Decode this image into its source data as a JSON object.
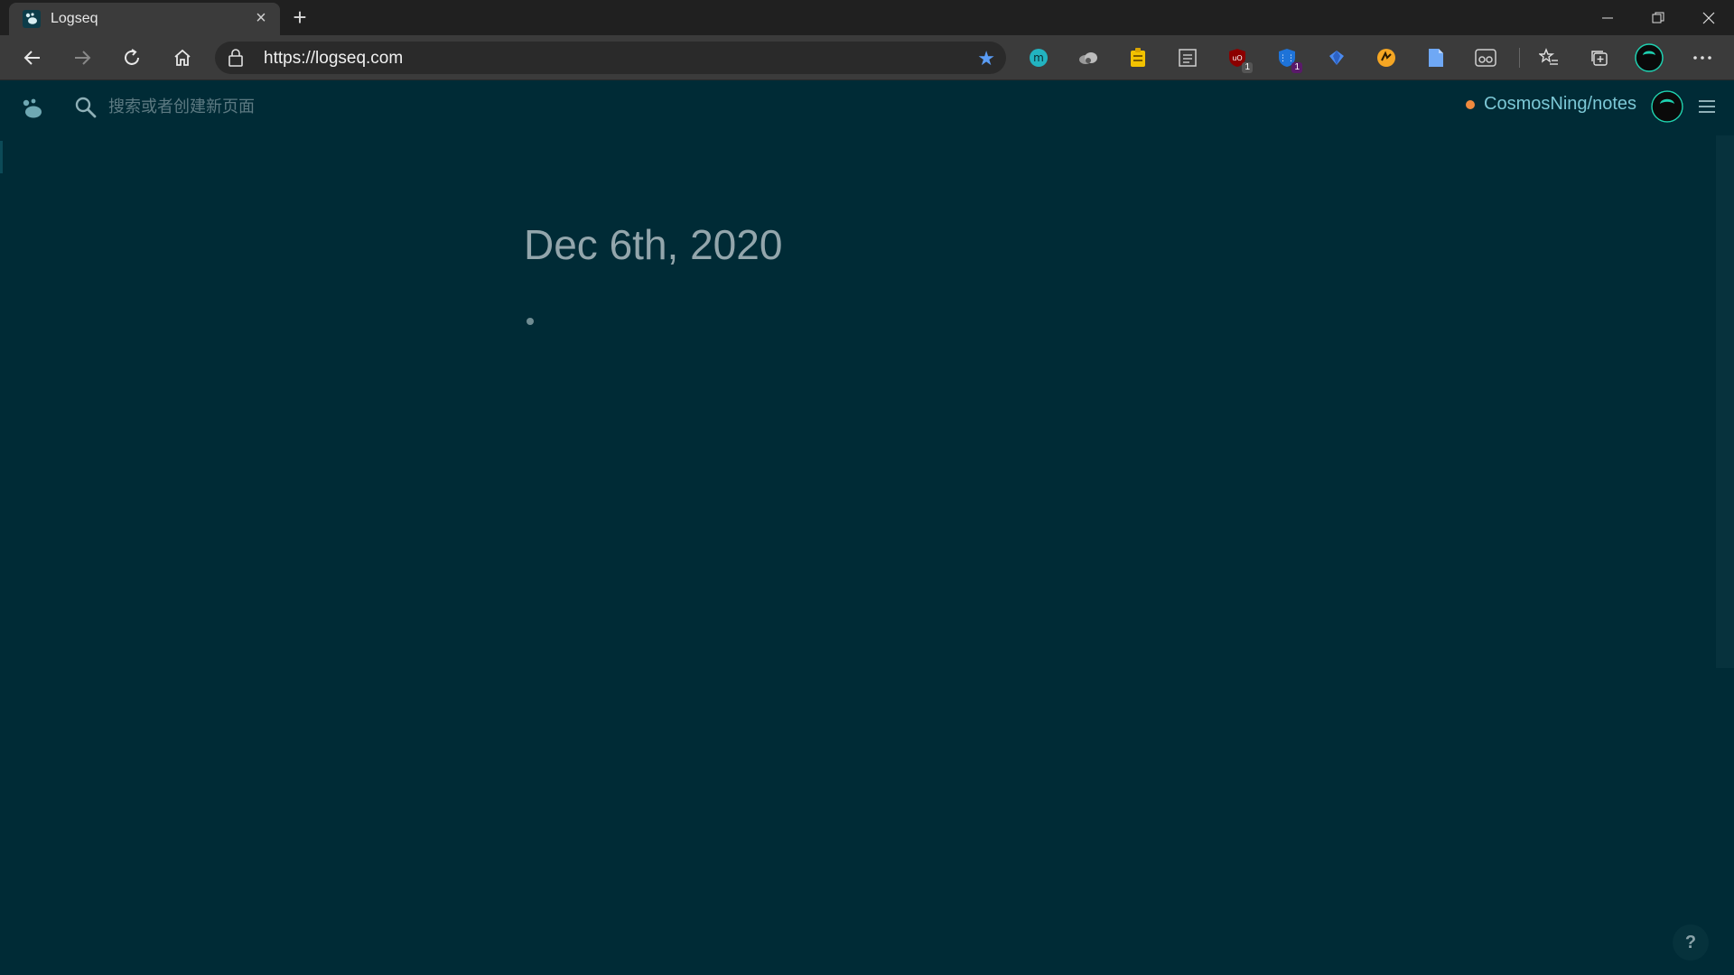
{
  "browser": {
    "tab": {
      "title": "Logseq"
    },
    "address": {
      "url": "https://logseq.com"
    },
    "extensions": [
      {
        "name": "m-extension-icon",
        "badge": ""
      },
      {
        "name": "cloud-extension-icon",
        "badge": ""
      },
      {
        "name": "notes-extension-icon",
        "badge": ""
      },
      {
        "name": "reader-extension-icon",
        "badge": ""
      },
      {
        "name": "ublock-extension-icon",
        "badge": "1"
      },
      {
        "name": "shield-extension-icon",
        "badge": "1"
      },
      {
        "name": "gem-extension-icon",
        "badge": ""
      },
      {
        "name": "orange-extension-icon",
        "badge": ""
      },
      {
        "name": "doc-extension-icon",
        "badge": ""
      },
      {
        "name": "glasses-extension-icon",
        "badge": ""
      }
    ]
  },
  "app": {
    "search": {
      "placeholder": "搜索或者创建新页面"
    },
    "repo": {
      "name": "CosmosNing/notes"
    },
    "page": {
      "title": "Dec 6th, 2020"
    },
    "help": {
      "label": "?"
    },
    "colors": {
      "background": "#002b36",
      "accent": "#7cc8d6",
      "status_dot": "#f08a3e"
    }
  }
}
